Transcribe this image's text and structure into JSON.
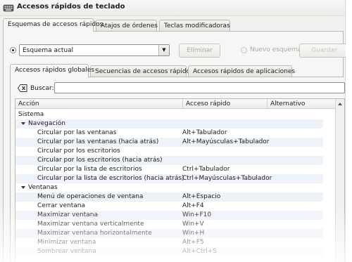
{
  "window": {
    "title": "Accesos rápidos de teclado"
  },
  "main_tabs": [
    {
      "label": "Esquemas de accesos rápidos",
      "active": true
    },
    {
      "label": "Atajos de órdenes",
      "active": false
    },
    {
      "label": "Teclas modificadoras",
      "active": false
    }
  ],
  "scheme": {
    "current_label": "Esquema actual",
    "remove_label": "Eliminar",
    "new_scheme_label": "Nuevo esquema",
    "save_label": "Guardar"
  },
  "sub_tabs": [
    {
      "label": "Accesos rápidos globales",
      "active": true
    },
    {
      "label": "Secuencias de accesos rápidos",
      "active": false
    },
    {
      "label": "Accesos rápidos de aplicaciones",
      "active": false
    }
  ],
  "search": {
    "label": "Buscar:",
    "value": ""
  },
  "columns": {
    "action": "Acción",
    "shortcut": "Acceso rápido",
    "alternative": "Alternativo"
  },
  "rows": [
    {
      "level": 0,
      "action": "Sistema",
      "shortcut": ""
    },
    {
      "level": 1,
      "expander": true,
      "action": "Navegación",
      "shortcut": ""
    },
    {
      "level": 2,
      "action": "Circular por las ventanas",
      "shortcut": "Alt+Tabulador"
    },
    {
      "level": 2,
      "action": "Circular por las ventanas (hacia atrás)",
      "shortcut": "Alt+Mayúsculas+Tabulador"
    },
    {
      "level": 2,
      "action": "Circular por los escritorios",
      "shortcut": ""
    },
    {
      "level": 2,
      "action": "Circular por los escritorios (hacia atrás)",
      "shortcut": ""
    },
    {
      "level": 2,
      "action": "Circular por la lista de escritorios",
      "shortcut": "Ctrl+Tabulador"
    },
    {
      "level": 2,
      "action": "Circular por la lista de escritorios (hacia atrás)",
      "shortcut": "Ctrl+Mayúsculas+Tabulador"
    },
    {
      "level": 1,
      "expander": true,
      "action": "Ventanas",
      "shortcut": ""
    },
    {
      "level": 2,
      "action": "Menú de operaciones de ventana",
      "shortcut": "Alt+Espacio"
    },
    {
      "level": 2,
      "action": "Cerrar ventana",
      "shortcut": "Alt+F4"
    },
    {
      "level": 2,
      "action": "Maximizar ventana",
      "shortcut": "Win+F10"
    },
    {
      "level": 2,
      "action": "Maximizar ventana verticalmente",
      "shortcut": "Win+V"
    },
    {
      "level": 2,
      "action": "Maximizar ventana horizontalmente",
      "shortcut": "Win+H"
    },
    {
      "level": 2,
      "action": "Minimizar ventana",
      "shortcut": "Alt+F5"
    },
    {
      "level": 2,
      "action": "Sombrear ventana",
      "shortcut": "Alt+Ctrl+S"
    }
  ],
  "icons": {
    "app": "keyboard-icon",
    "clear": "clear-search-icon",
    "dropdown": "chevron-down-icon"
  }
}
